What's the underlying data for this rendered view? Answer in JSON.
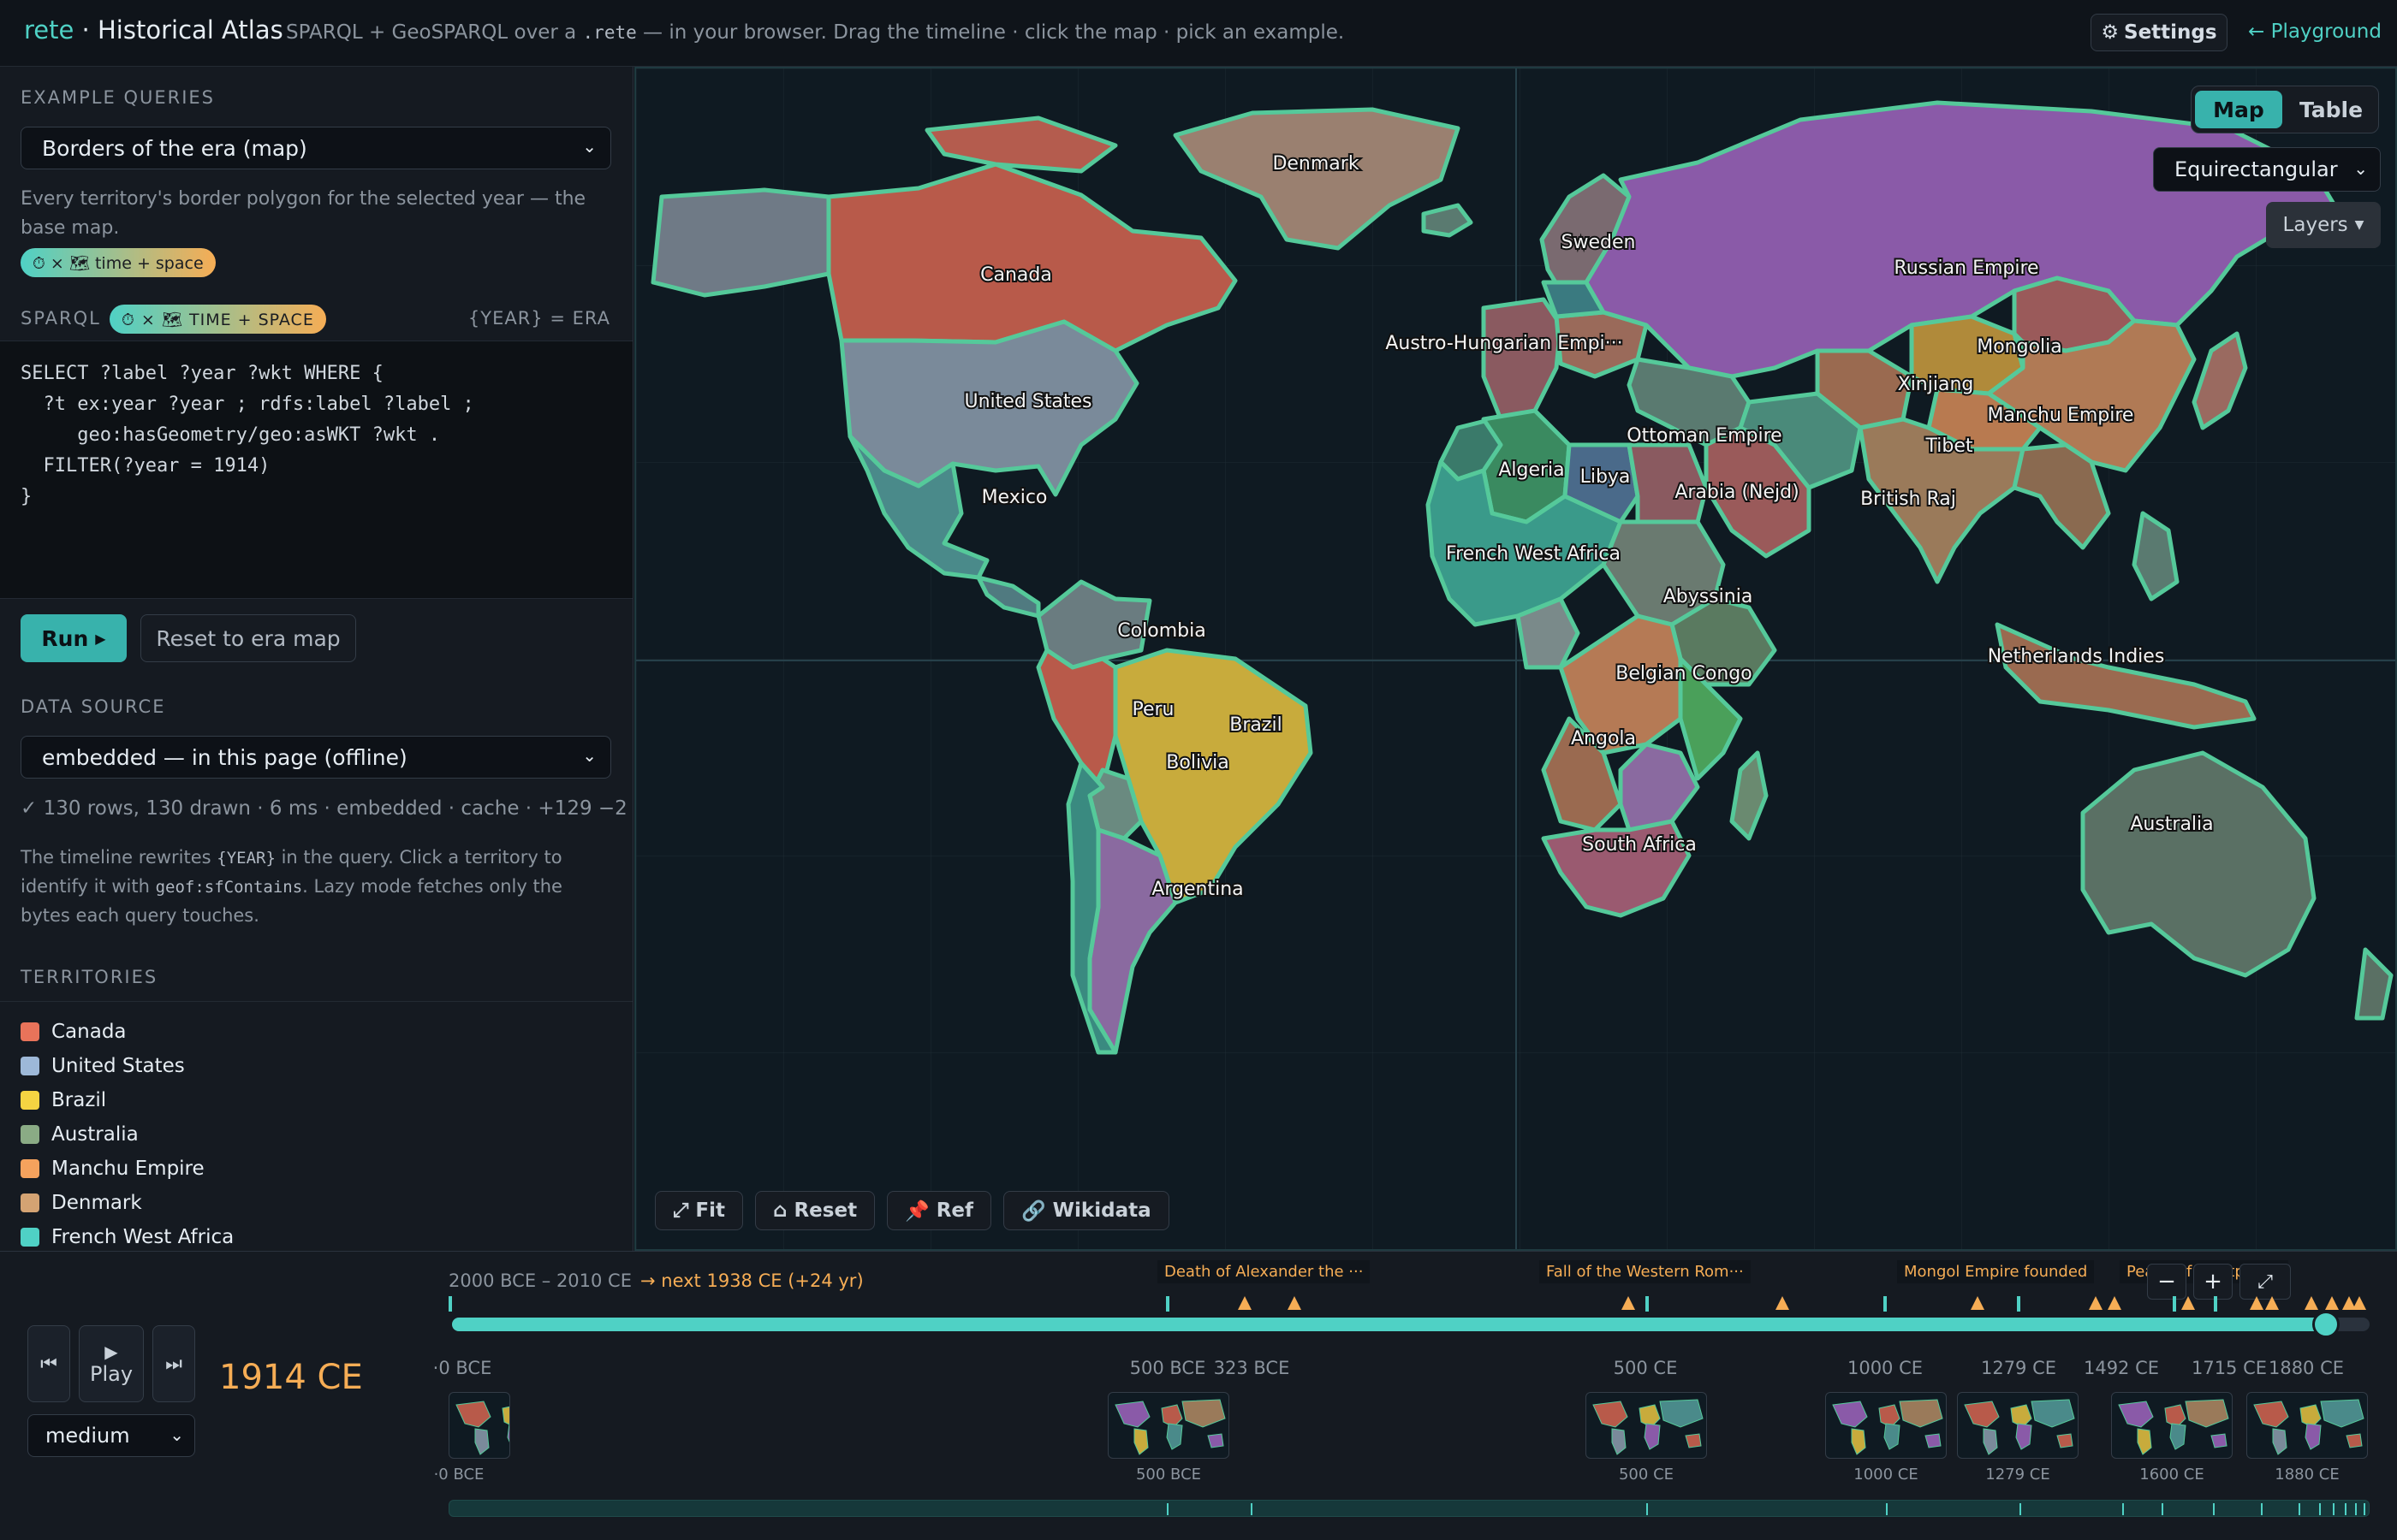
{
  "header": {
    "brand_main": "rete",
    "brand_sep": " · ",
    "brand_title": "Historical Atlas",
    "tagline_pre": "SPARQL + GeoSPARQL over a ",
    "tagline_code": ".rete",
    "tagline_post": " — in your browser. Drag the timeline · click the map · pick an example.",
    "settings_label": "Settings",
    "settings_icon": "gear-icon",
    "playground_label": "← Playground"
  },
  "sidebar": {
    "example_title": "EXAMPLE QUERIES",
    "example_selected": "Borders of the era (map)",
    "query_description": "Every territory's border polygon for the selected year — the base map.",
    "query_pill": "⏱ × 🗺 time + space",
    "sparql_label": "SPARQL",
    "sparql_pill": "⏱ × 🗺 TIME + SPACE",
    "year_era": "{YEAR} = ERA",
    "code": "SELECT ?label ?year ?wkt WHERE {\n  ?t ex:year ?year ; rdfs:label ?label ;\n     geo:hasGeometry/geo:asWKT ?wkt .\n  FILTER(?year = 1914)\n}",
    "run_label": "Run",
    "reset_label": "Reset to era map",
    "data_source_title": "DATA SOURCE",
    "data_source_selected": "embedded — in this page (offline)",
    "status": "✓ 130 rows, 130 drawn · 6 ms · embedded · cache · +129 −2",
    "help_1": "The timeline rewrites ",
    "help_code_1": "{YEAR}",
    "help_2": " in the query. Click a territory to identify it with ",
    "help_code_2": "geof:sfContains",
    "help_3": ". Lazy mode fetches only the bytes each query touches.",
    "territories_title": "TERRITORIES",
    "territories": [
      {
        "name": "Canada",
        "color": "#e8735a"
      },
      {
        "name": "United States",
        "color": "#9db8d8"
      },
      {
        "name": "Brazil",
        "color": "#f5d442"
      },
      {
        "name": "Australia",
        "color": "#8aab85"
      },
      {
        "name": "Manchu Empire",
        "color": "#f5a25d"
      },
      {
        "name": "Denmark",
        "color": "#d4a373"
      },
      {
        "name": "French West Africa",
        "color": "#4fd1c5"
      }
    ]
  },
  "map": {
    "view_options": [
      "Map",
      "Table"
    ],
    "view_active": "Map",
    "projection": "Equirectangular",
    "layers_label": "Layers",
    "labels": [
      "Denmark",
      "Canada",
      "Sweden",
      "Russian Empire",
      "Austro-Hungarian Empi···",
      "United States",
      "Mongolia",
      "Xinjiang",
      "Manchu Empire",
      "Ottoman Empire",
      "Tibet",
      "Algeria",
      "Libya",
      "Mexico",
      "Arabia (Nejd)",
      "British Raj",
      "French West Africa",
      "Abyssinia",
      "Colombia",
      "Netherlands Indies",
      "Belgian Congo",
      "Brazil",
      "Peru",
      "Angola",
      "Bolivia",
      "Australia",
      "South Africa",
      "Argentina"
    ],
    "tools": [
      {
        "label": "Fit",
        "icon": "expand-icon",
        "glyph": "⤢"
      },
      {
        "label": "Reset",
        "icon": "home-icon",
        "glyph": "⌂"
      },
      {
        "label": "Ref",
        "icon": "pin-icon",
        "glyph": "📌"
      },
      {
        "label": "Wikidata",
        "icon": "link-icon",
        "glyph": "🔗"
      }
    ]
  },
  "timeline": {
    "play_label": "Play",
    "current_year": "1914 CE",
    "speed": "medium",
    "range_label": "2000 BCE – 2010 CE",
    "next_label": "→ next 1938 CE (+24 yr)",
    "progress": 0.9771,
    "events": [
      "Death of Alexander the ···",
      "Fall of the Western Rom···",
      "Mongol Empire founded",
      "Peace of Westphalia"
    ],
    "era_labels": [
      "·0 BCE",
      "500 BCE",
      "323 BCE",
      "500 CE",
      "1000 CE",
      "1279 CE",
      "1492 CE",
      "1715 CE",
      "1880 CE"
    ],
    "thumb_labels": [
      "·0 BCE",
      "500 BCE",
      "500 CE",
      "1000 CE",
      "1279 CE",
      "1600 CE",
      "1880 CE"
    ],
    "zoom_minus": "−",
    "zoom_plus": "+"
  }
}
